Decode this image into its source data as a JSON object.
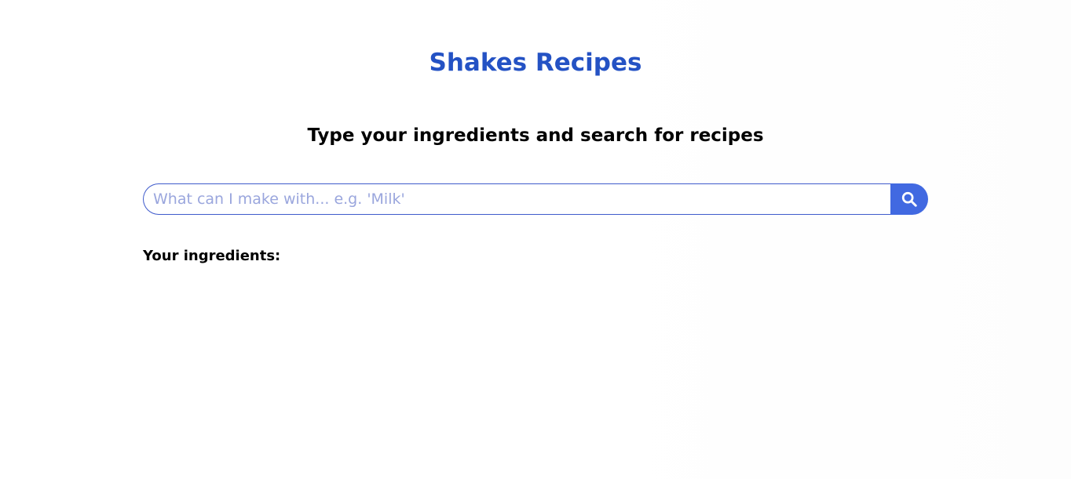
{
  "header": {
    "title": "Shakes Recipes",
    "subtitle": "Type your ingredients and search for recipes"
  },
  "search": {
    "placeholder": "What can I make with... e.g. 'Milk'",
    "value": "",
    "button_icon": "search-icon"
  },
  "ingredients": {
    "label": "Your ingredients:",
    "items": []
  },
  "colors": {
    "title": "#2452c4",
    "accent": "#4169e1",
    "input_border": "#3f5bcc",
    "placeholder": "#9aa6dd"
  }
}
